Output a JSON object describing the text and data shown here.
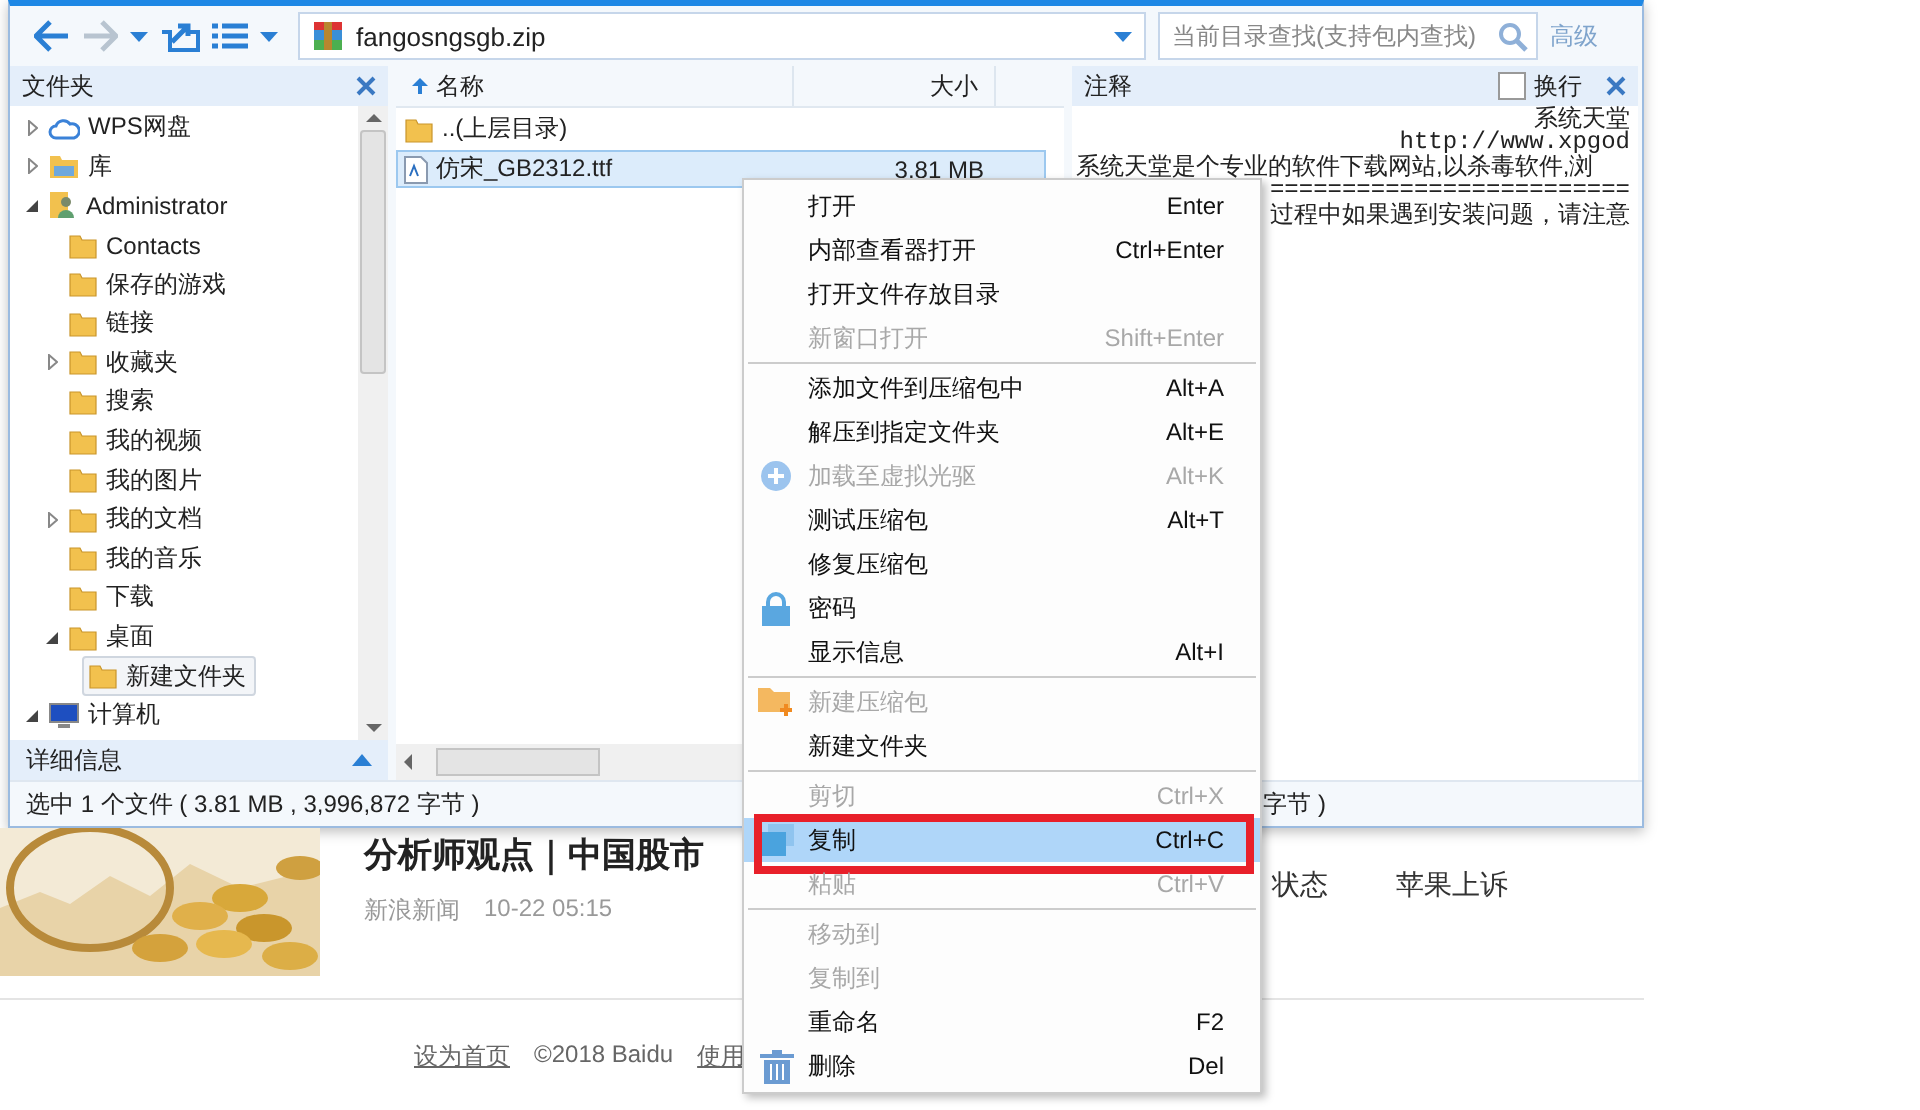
{
  "window": {
    "toolbar": {
      "address": "fangosngsgb.zip",
      "search_placeholder": "当前目录查找(支持包内查找)",
      "advanced_link": "高级"
    },
    "folder_pane": {
      "title": "文件夹",
      "details_label": "详细信息",
      "tree": [
        {
          "label": "WPS网盘",
          "kind": "cloud",
          "expanded": false
        },
        {
          "label": "库",
          "kind": "library",
          "expanded": false
        },
        {
          "label": "Administrator",
          "kind": "user",
          "expanded": true,
          "children": [
            {
              "label": "Contacts",
              "kind": "folder"
            },
            {
              "label": "保存的游戏",
              "kind": "folder"
            },
            {
              "label": "链接",
              "kind": "folder"
            },
            {
              "label": "收藏夹",
              "kind": "folder",
              "expanded": false
            },
            {
              "label": "搜索",
              "kind": "folder"
            },
            {
              "label": "我的视频",
              "kind": "folder"
            },
            {
              "label": "我的图片",
              "kind": "folder"
            },
            {
              "label": "我的文档",
              "kind": "folder",
              "expanded": false
            },
            {
              "label": "我的音乐",
              "kind": "folder"
            },
            {
              "label": "下载",
              "kind": "folder"
            },
            {
              "label": "桌面",
              "kind": "folder",
              "expanded": true,
              "children": [
                {
                  "label": "新建文件夹",
                  "kind": "folder",
                  "selected": true
                }
              ]
            }
          ]
        },
        {
          "label": "计算机",
          "kind": "computer",
          "expanded": true
        }
      ]
    },
    "file_list": {
      "columns": [
        {
          "label": "名称",
          "sorted": true
        },
        {
          "label": "大小",
          "sorted": false
        }
      ],
      "rows": [
        {
          "name": "..(上层目录)",
          "kind": "parent",
          "selected": false
        },
        {
          "name": "仿宋_GB2312.ttf",
          "kind": "font",
          "size": "3.81 MB",
          "selected": true
        }
      ]
    },
    "comment_pane": {
      "title": "注释",
      "wrap": {
        "label": "换行",
        "checked": false
      },
      "lines": [
        {
          "text": "系统天堂",
          "kind": "heading"
        },
        {
          "text": "http://www.xpgod",
          "kind": "url"
        },
        {
          "text": "系统天堂是个专业的软件下载网站,以杀毒软件,浏",
          "kind": "body"
        },
        {
          "text": "=========================",
          "kind": "rule"
        },
        {
          "text": "过程中如果遇到安装问题，请注意",
          "kind": "continuation"
        }
      ]
    },
    "status_bar": {
      "text": "选中 1 个文件 ( 3.81 MB , 3,996,872 字节 )",
      "right_text": "字节 )"
    }
  },
  "context_menu": {
    "items": [
      {
        "kind": "item",
        "label": "打开",
        "shortcut": "Enter",
        "disabled": false,
        "selected": false
      },
      {
        "kind": "item",
        "label": "内部查看器打开",
        "shortcut": "Ctrl+Enter",
        "disabled": false,
        "selected": false
      },
      {
        "kind": "item",
        "label": "打开文件存放目录",
        "disabled": false,
        "selected": false
      },
      {
        "kind": "item",
        "label": "新窗口打开",
        "shortcut": "Shift+Enter",
        "disabled": true,
        "selected": false
      },
      {
        "kind": "separator"
      },
      {
        "kind": "item",
        "label": "添加文件到压缩包中",
        "shortcut": "Alt+A",
        "disabled": false,
        "selected": false
      },
      {
        "kind": "item",
        "label": "解压到指定文件夹",
        "shortcut": "Alt+E",
        "disabled": false,
        "selected": false
      },
      {
        "kind": "item",
        "label": "加载至虚拟光驱",
        "shortcut": "Alt+K",
        "disabled": true,
        "selected": false
      },
      {
        "kind": "item",
        "label": "测试压缩包",
        "shortcut": "Alt+T",
        "disabled": false,
        "selected": false
      },
      {
        "kind": "item",
        "label": "修复压缩包",
        "disabled": false,
        "selected": false
      },
      {
        "kind": "item",
        "label": "密码",
        "disabled": false,
        "selected": false
      },
      {
        "kind": "item",
        "label": "显示信息",
        "shortcut": "Alt+I",
        "disabled": false,
        "selected": false
      },
      {
        "kind": "separator"
      },
      {
        "kind": "item",
        "label": "新建压缩包",
        "disabled": true,
        "selected": false
      },
      {
        "kind": "item",
        "label": "新建文件夹",
        "disabled": false,
        "selected": false
      },
      {
        "kind": "separator"
      },
      {
        "kind": "item",
        "label": "剪切",
        "shortcut": "Ctrl+X",
        "disabled": true,
        "selected": false
      },
      {
        "kind": "item",
        "label": "复制",
        "shortcut": "Ctrl+C",
        "disabled": false,
        "selected": true,
        "annotated": true
      },
      {
        "kind": "item",
        "label": "粘贴",
        "shortcut": "Ctrl+V",
        "disabled": true,
        "selected": false
      },
      {
        "kind": "separator"
      },
      {
        "kind": "item",
        "label": "移动到",
        "disabled": true,
        "selected": false
      },
      {
        "kind": "item",
        "label": "复制到",
        "disabled": true,
        "selected": false
      },
      {
        "kind": "item",
        "label": "重命名",
        "shortcut": "F2",
        "disabled": false,
        "selected": false
      },
      {
        "kind": "item",
        "label": "删除",
        "shortcut": "Del",
        "disabled": false,
        "selected": false
      }
    ]
  },
  "news": {
    "headline": "分析师观点｜中国股市",
    "source": "新浪新闻",
    "time": "10-22 05:15",
    "tags": [
      "状态",
      "苹果上诉"
    ]
  },
  "footer": {
    "items": [
      {
        "text": "设为首页",
        "kind": "link"
      },
      {
        "text": "©2018 Baidu",
        "kind": "text"
      },
      {
        "text": "使用",
        "kind": "link"
      }
    ]
  }
}
